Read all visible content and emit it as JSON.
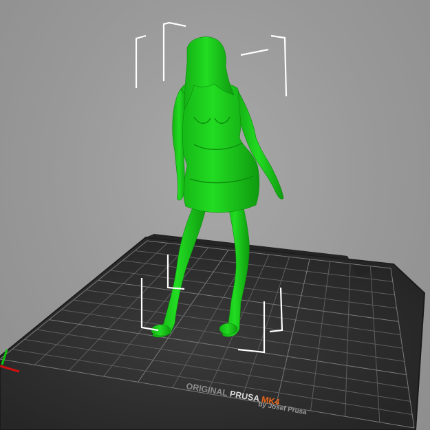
{
  "bed": {
    "brand_prefix": "ORIGINAL",
    "brand_name": "PRUSA",
    "model": "MK4",
    "byline": "by Josef Prusa"
  },
  "colors": {
    "background": "#9a9a9a",
    "bed_plate": "#2b2b2b",
    "grid_line": "#6a6a6a",
    "model_selected": "#1fd41f",
    "model_shade": "#12a312",
    "bounding_box": "#ffffff",
    "model_accent": "#e8661a",
    "axis_x": "#d01010",
    "axis_y": "#10c010"
  },
  "object": {
    "name": "figure-model",
    "state": "selected"
  }
}
